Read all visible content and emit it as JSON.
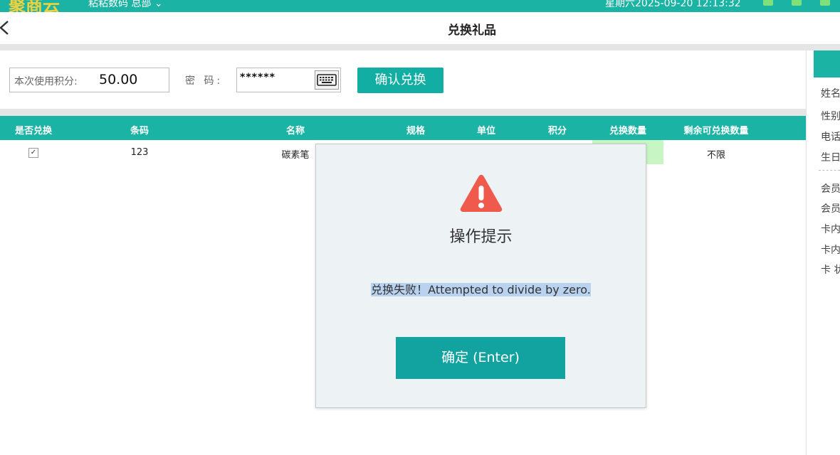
{
  "topbar": {
    "logo": "聚商云",
    "shop": "粘粘数码 总部 ⌄",
    "datetime": "星期六2025-09-20 12:13:32"
  },
  "header": {
    "title": "兑换礼品"
  },
  "form": {
    "points_label": "本次使用积分:",
    "points_value": "50.00",
    "password_label": "密 码:",
    "password_value": "******",
    "confirm_button": "确认兑换"
  },
  "table": {
    "columns": [
      "是否兑换",
      "条码",
      "名称",
      "规格",
      "单位",
      "积分",
      "兑换数量",
      "剩余可兑换数量"
    ],
    "rows": [
      {
        "checked": "✓",
        "barcode": "123",
        "name": "碳素笔",
        "remaining": "不限"
      }
    ]
  },
  "right_panel": {
    "items": [
      "姓名",
      "性别",
      "电话",
      "生日",
      "会员",
      "会员",
      "卡内",
      "卡内",
      "卡 状"
    ]
  },
  "dialog": {
    "title": "操作提示",
    "message": "兑换失败！Attempted to divide by zero.",
    "ok_button": "确定 (Enter)"
  },
  "colors": {
    "accent": "#1bb3a4",
    "button": "#12aea4",
    "warning": "#ef5a4c"
  }
}
